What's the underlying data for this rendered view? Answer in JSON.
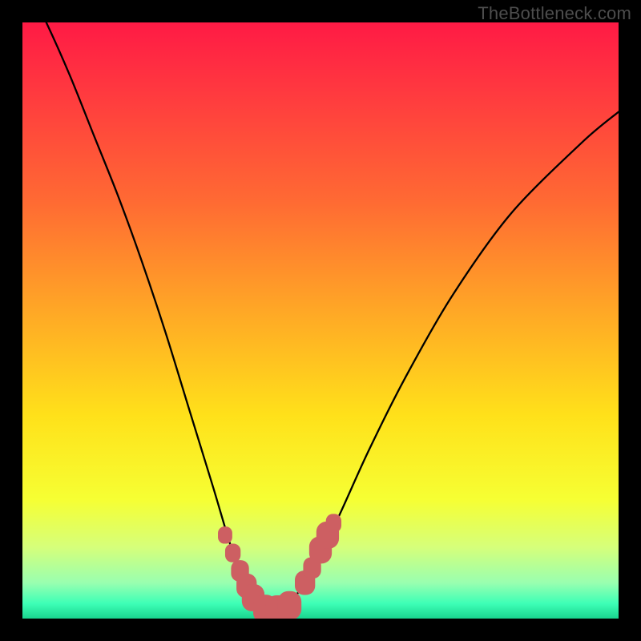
{
  "watermark": "TheBottleneck.com",
  "colors": {
    "black": "#000000",
    "curve": "#000000",
    "marker_fill": "#cd5f62",
    "gradient_stops": [
      {
        "offset": 0.0,
        "color": "#ff1a45"
      },
      {
        "offset": 0.12,
        "color": "#ff3a3f"
      },
      {
        "offset": 0.3,
        "color": "#ff6a33"
      },
      {
        "offset": 0.48,
        "color": "#ffa626"
      },
      {
        "offset": 0.66,
        "color": "#ffe11a"
      },
      {
        "offset": 0.8,
        "color": "#f6ff33"
      },
      {
        "offset": 0.88,
        "color": "#d6ff7a"
      },
      {
        "offset": 0.94,
        "color": "#99ffb0"
      },
      {
        "offset": 0.975,
        "color": "#3dffb6"
      },
      {
        "offset": 1.0,
        "color": "#19d48e"
      }
    ]
  },
  "chart_data": {
    "type": "line",
    "title": "",
    "xlabel": "",
    "ylabel": "",
    "xlim": [
      0,
      100
    ],
    "ylim": [
      0,
      100
    ],
    "grid": false,
    "series": [
      {
        "name": "bottleneck-curve",
        "x": [
          0,
          4,
          8,
          12,
          16,
          20,
          24,
          28,
          32,
          35,
          37,
          38.5,
          40,
          41.5,
          43,
          44.5,
          46,
          49,
          53,
          58,
          64,
          72,
          82,
          94,
          100
        ],
        "y": [
          108,
          100,
          91,
          81,
          71,
          60,
          48,
          35,
          22,
          12,
          7,
          4,
          2,
          1.2,
          1.2,
          2,
          4,
          9,
          17,
          28,
          40,
          54,
          68,
          80,
          85
        ]
      }
    ],
    "markers": [
      {
        "name": "left-1",
        "x": 34.0,
        "y": 14.0,
        "r": 1.2
      },
      {
        "name": "left-2",
        "x": 35.3,
        "y": 11.0,
        "r": 1.3
      },
      {
        "name": "left-3",
        "x": 36.5,
        "y": 8.0,
        "r": 1.5
      },
      {
        "name": "left-4",
        "x": 37.6,
        "y": 5.5,
        "r": 1.7
      },
      {
        "name": "left-5",
        "x": 38.7,
        "y": 3.5,
        "r": 1.9
      },
      {
        "name": "flat-1",
        "x": 40.7,
        "y": 1.6,
        "r": 2.0
      },
      {
        "name": "flat-2",
        "x": 42.8,
        "y": 1.5,
        "r": 2.0
      },
      {
        "name": "flat-3",
        "x": 44.8,
        "y": 2.2,
        "r": 2.0
      },
      {
        "name": "right-1",
        "x": 47.4,
        "y": 6.0,
        "r": 1.7
      },
      {
        "name": "right-2",
        "x": 48.6,
        "y": 8.5,
        "r": 1.5
      },
      {
        "name": "right-3",
        "x": 50.0,
        "y": 11.5,
        "r": 1.9
      },
      {
        "name": "right-4",
        "x": 51.2,
        "y": 14.0,
        "r": 1.9
      },
      {
        "name": "right-5",
        "x": 52.2,
        "y": 16.0,
        "r": 1.3
      }
    ]
  }
}
